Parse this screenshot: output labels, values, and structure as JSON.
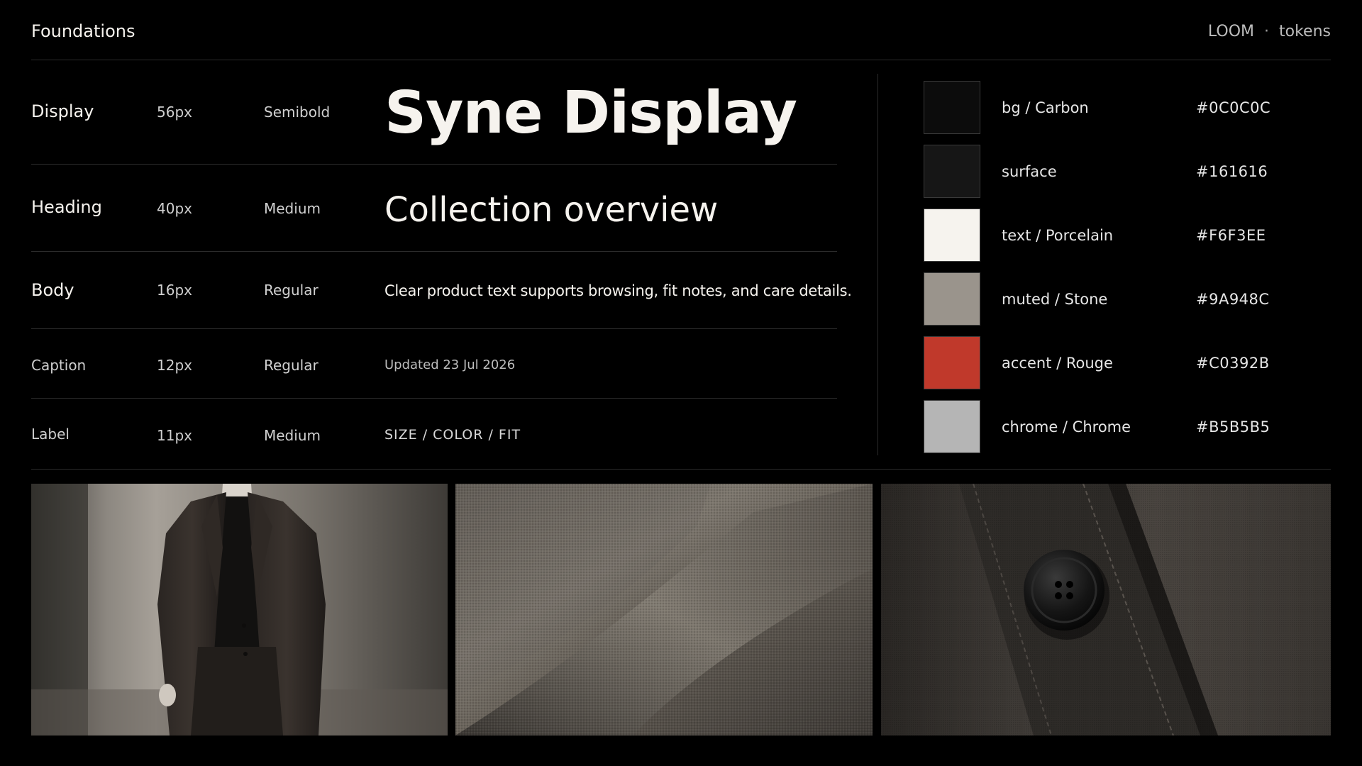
{
  "header": {
    "title": "Foundations",
    "brand": "LOOM",
    "separator": "·",
    "section": "tokens"
  },
  "typography": [
    {
      "name": "Display",
      "size": "56px",
      "weight": "Semibold",
      "sample": "Syne Display"
    },
    {
      "name": "Heading",
      "size": "40px",
      "weight": "Medium",
      "sample": "Collection overview"
    },
    {
      "name": "Body",
      "size": "16px",
      "weight": "Regular",
      "sample": "Clear product text supports browsing, fit notes, and care details."
    },
    {
      "name": "Caption",
      "size": "12px",
      "weight": "Regular",
      "sample": "Updated 23 Jul 2026"
    },
    {
      "name": "Label",
      "size": "11px",
      "weight": "Medium",
      "sample": "SIZE / COLOR / FIT"
    }
  ],
  "palette": [
    {
      "token": "bg / Carbon",
      "hex": "#0C0C0C"
    },
    {
      "token": "surface",
      "hex": "#161616"
    },
    {
      "token": "text / Porcelain",
      "hex": "#F6F3EE"
    },
    {
      "token": "muted / Stone",
      "hex": "#9A948C"
    },
    {
      "token": "accent / Rouge",
      "hex": "#C0392B"
    },
    {
      "token": "chrome / Chrome",
      "hex": "#B5B5B5"
    }
  ],
  "gallery": [
    {
      "icon": "tailored-jacket-photo"
    },
    {
      "icon": "fabric-texture-photo"
    },
    {
      "icon": "button-detail-photo"
    }
  ]
}
